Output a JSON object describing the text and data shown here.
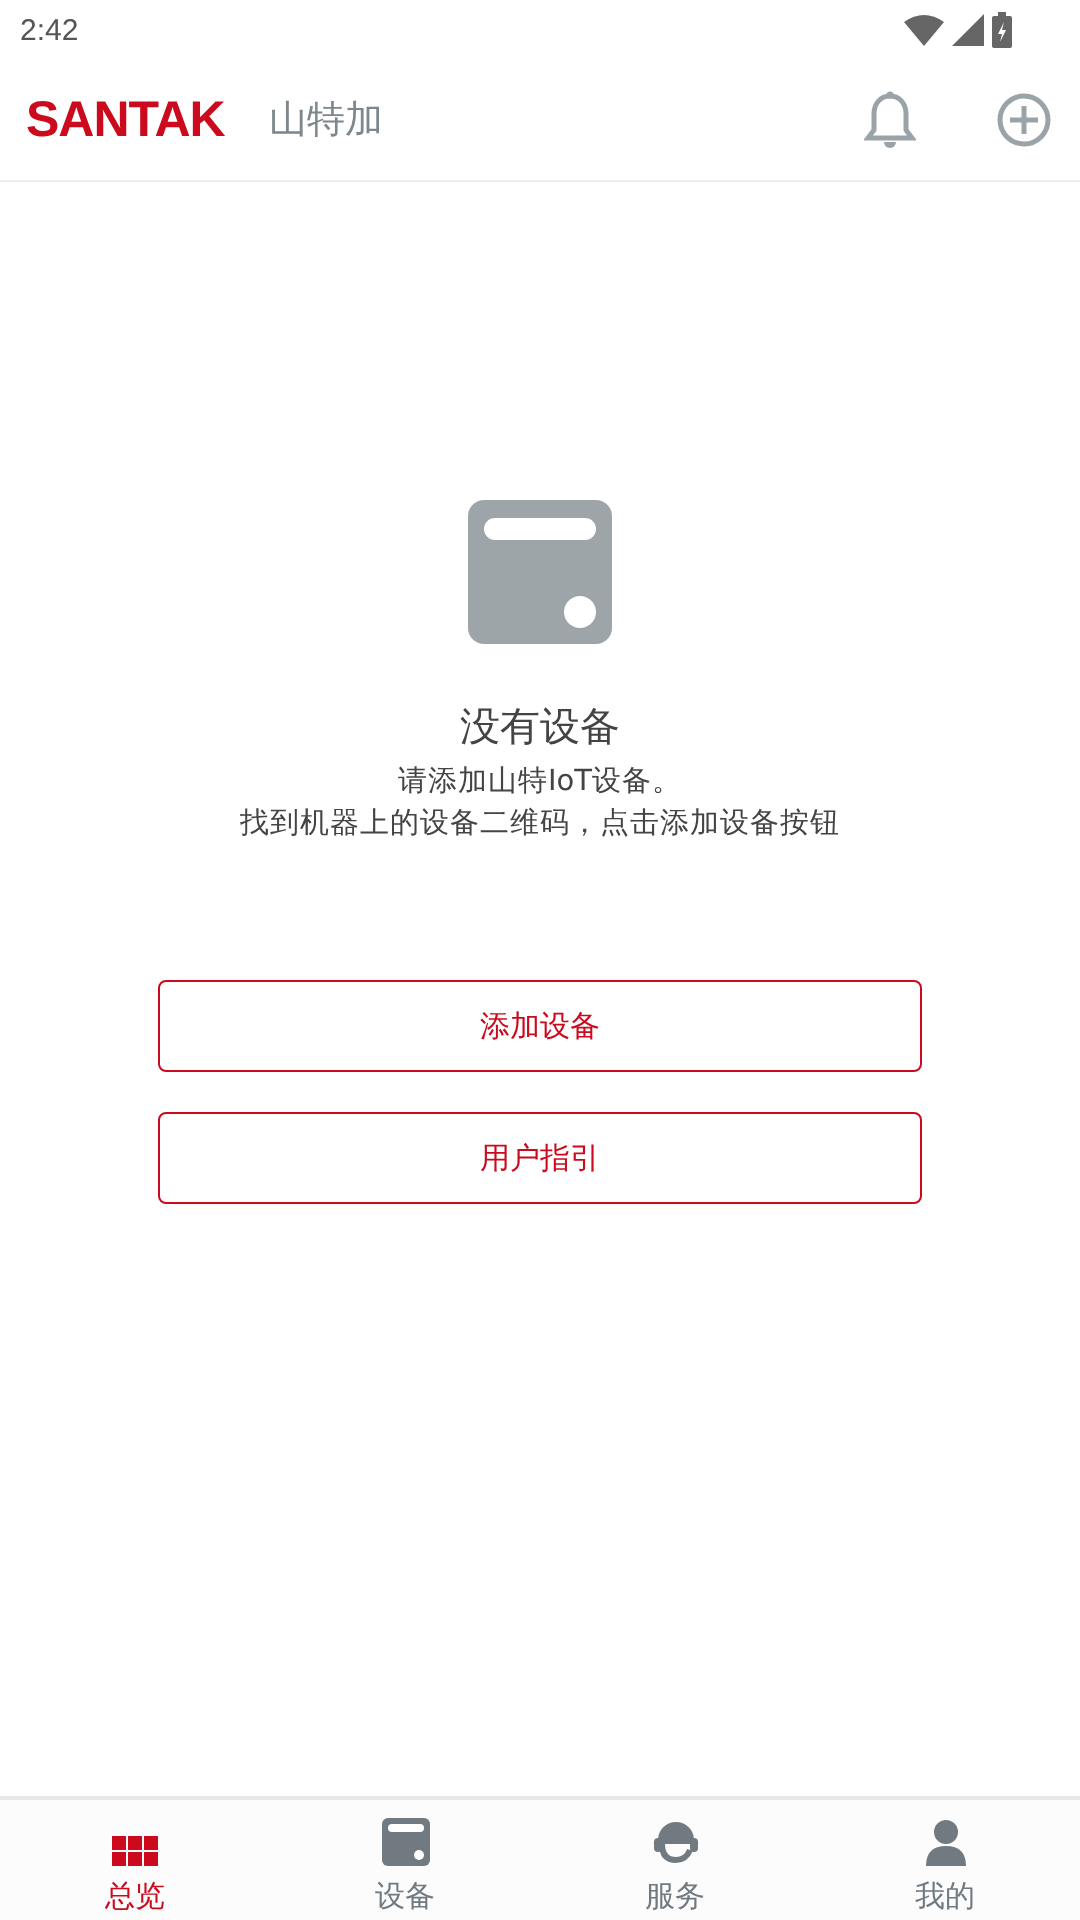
{
  "status_bar": {
    "time": "2:42"
  },
  "header": {
    "logo": "SANTAK",
    "title": "山特加"
  },
  "empty_state": {
    "title": "没有设备",
    "lines": [
      "请添加山特IoT设备。",
      "找到机器上的设备二维码，点击添加设备按钮"
    ]
  },
  "buttons": [
    "添加设备",
    "用户指引"
  ],
  "nav": [
    {
      "label": "总览",
      "kind": "grid",
      "selected": true
    },
    {
      "label": "设备",
      "kind": "device",
      "selected": false
    },
    {
      "label": "服务",
      "kind": "support",
      "selected": false
    },
    {
      "label": "我的",
      "kind": "person",
      "selected": false
    }
  ]
}
